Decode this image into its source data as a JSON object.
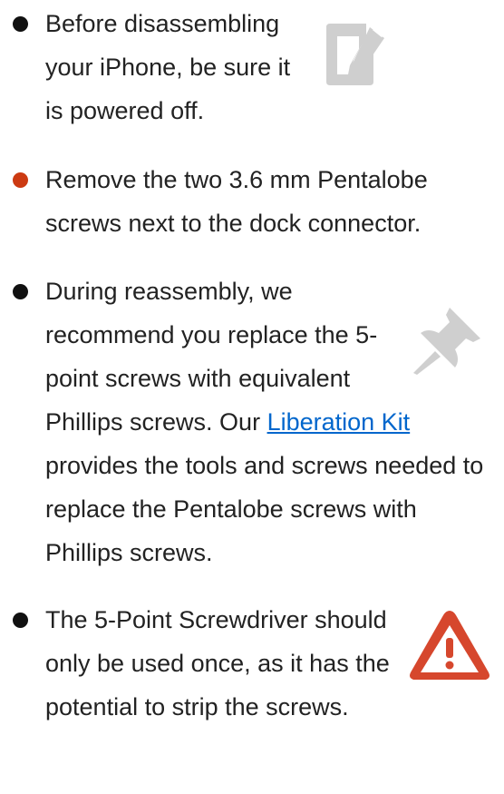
{
  "colors": {
    "bullet_black": "#111111",
    "bullet_red": "#cc3a12",
    "link": "#0066cc",
    "icon_gray": "#cfcfcf",
    "caution_red": "#d6472d"
  },
  "bullets": [
    {
      "color": "black",
      "icon": "note-icon",
      "text": "Before disassembling your iPhone, be sure it is powered off."
    },
    {
      "color": "red",
      "text": "Remove the two 3.6 mm Pentalobe screws next to the dock connector."
    },
    {
      "color": "black",
      "icon": "pin-icon",
      "text_before": "During reassembly, we recommend you replace the 5-point screws with equivalent Phillips screws. Our ",
      "link_text": "Liberation Kit",
      "text_after": " provides the tools and screws needed to replace the Pentalobe screws with Phillips screws."
    },
    {
      "color": "black",
      "icon": "caution-icon",
      "text": "The 5-Point Screwdriver should only be used once, as it has the potential to strip the screws."
    }
  ]
}
